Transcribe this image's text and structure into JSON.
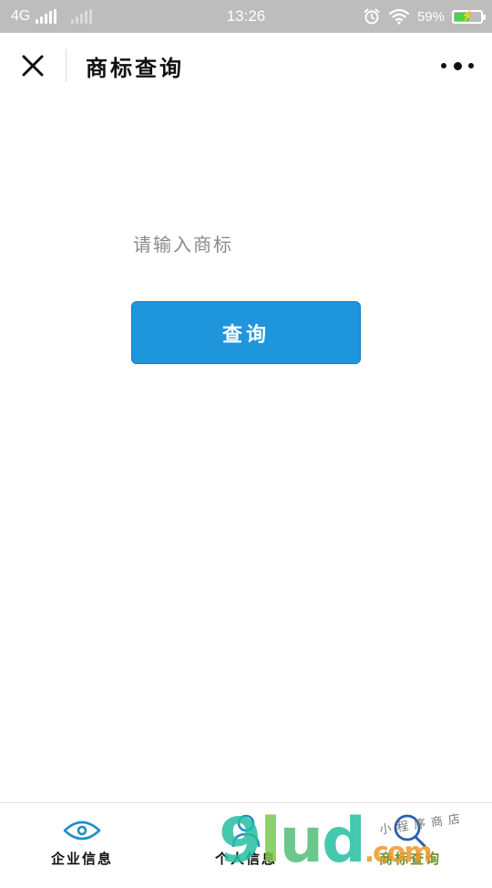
{
  "status_bar": {
    "network": "4G",
    "time": "13:26",
    "battery_percent_text": "59%",
    "battery_level": 0.59,
    "icons": [
      "signal-icon",
      "signal-icon-dim",
      "alarm-icon",
      "wifi-icon",
      "battery-icon"
    ]
  },
  "navbar": {
    "title": "商标查询",
    "close_icon": "close-icon",
    "more_icon": "more-icon"
  },
  "search": {
    "placeholder": "请输入商标",
    "value": ""
  },
  "query_button": {
    "label": "查询"
  },
  "tabbar": {
    "tabs": [
      {
        "label": "企业信息",
        "icon": "eye-icon",
        "active": false
      },
      {
        "label": "个人信息",
        "icon": "person-icon",
        "active": false
      },
      {
        "label": "商标查询",
        "icon": "search-icon",
        "active": true
      }
    ],
    "active_color": "#6a8f2a"
  },
  "watermark": {
    "logo": "9lud.com",
    "tagline": "小程序商店"
  },
  "colors": {
    "status_bar_bg": "#bdbdbd",
    "primary_button": "#1f95dc",
    "eye_icon": "#1f8fc8"
  }
}
